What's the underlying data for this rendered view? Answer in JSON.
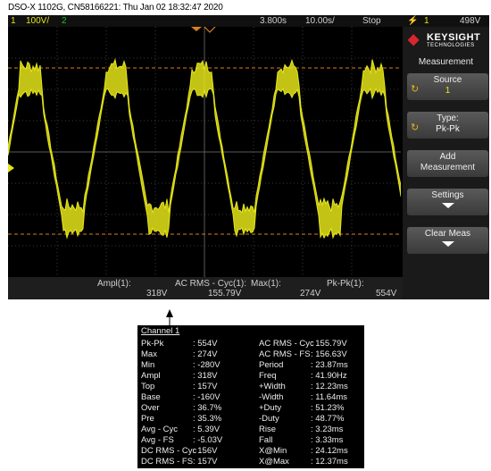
{
  "header": {
    "text": "DSO-X 1102G, CN58166221: Thu Jan 02 18:32:47 2020"
  },
  "topbar": {
    "ch1_num": "1",
    "ch1_scale": "100V/",
    "ch2_num": "2",
    "delay": "3.800s",
    "timebase": "10.00s/",
    "run_state": "Stop",
    "trig_icon": "trigger-edge-icon",
    "trig_ch": "1",
    "trig_level": "498V"
  },
  "panel": {
    "brand": "KEYSIGHT",
    "brand_sub": "TECHNOLOGIES",
    "title": "Measurement",
    "source_label": "Source",
    "source_value": "1",
    "type_label": "Type:",
    "type_value": "Pk-Pk",
    "add_line1": "Add",
    "add_line2": "Measurement",
    "settings_label": "Settings",
    "clear_label": "Clear Meas"
  },
  "measbar": [
    {
      "label": "Ampl(1):",
      "value": "318V"
    },
    {
      "label": "AC RMS - Cyc(1):",
      "value": "155.79V"
    },
    {
      "label": "Max(1):",
      "value": "274V"
    },
    {
      "label": "Pk-Pk(1):",
      "value": "554V"
    }
  ],
  "popup": {
    "title": "Channel 1",
    "left": [
      {
        "name": "Pk-Pk",
        "value": ": 554V"
      },
      {
        "name": "Max",
        "value": ": 274V"
      },
      {
        "name": "Min",
        "value": ": -280V"
      },
      {
        "name": "Ampl",
        "value": ": 318V"
      },
      {
        "name": "Top",
        "value": ": 157V"
      },
      {
        "name": "Base",
        "value": ": -160V"
      },
      {
        "name": "Over",
        "value": ": 36.7%"
      },
      {
        "name": "Pre",
        "value": ": 35.3%"
      },
      {
        "name": "Avg - Cyc",
        "value": ": 5.39V"
      },
      {
        "name": "Avg - FS",
        "value": ": -5.03V"
      },
      {
        "name": "DC RMS - Cyc",
        "value": ": 156V"
      },
      {
        "name": "DC RMS - FS",
        "value": ": 157V"
      }
    ],
    "right": [
      {
        "name": "AC RMS - Cyc",
        "value": ": 155.79V"
      },
      {
        "name": "AC RMS - FS",
        "value": ": 156.63V"
      },
      {
        "name": "Period",
        "value": ": 23.87ms"
      },
      {
        "name": "Freq",
        "value": ": 41.90Hz"
      },
      {
        "name": "+Width",
        "value": ": 12.23ms"
      },
      {
        "name": "-Width",
        "value": ": 11.64ms"
      },
      {
        "name": "+Duty",
        "value": ": 51.23%"
      },
      {
        "name": "-Duty",
        "value": ": 48.77%"
      },
      {
        "name": "Rise",
        "value": ": 3.23ms"
      },
      {
        "name": "Fall",
        "value": ": 3.33ms"
      },
      {
        "name": "X@Min",
        "value": ": 24.12ms"
      },
      {
        "name": "X@Max",
        "value": ": 12.37ms"
      }
    ]
  },
  "colors": {
    "ch1": "#e5e51a",
    "ch2": "#1fc51f",
    "cursor": "#d9801a",
    "brand": "#d8262e"
  }
}
